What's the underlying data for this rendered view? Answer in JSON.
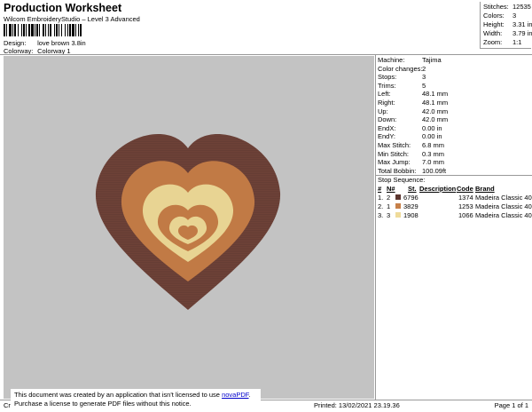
{
  "header": {
    "title": "Production Worksheet",
    "subtitle": "Wilcom EmbroideryStudio – Level 3 Advanced",
    "design_label": "Design:",
    "design_value": "love brown 3.8in",
    "colorway_label": "Colorway:",
    "colorway_value": "Colorway 1"
  },
  "stats": {
    "stitches_label": "Stitches:",
    "stitches_value": "12535",
    "colors_label": "Colors:",
    "colors_value": "3",
    "height_label": "Height:",
    "height_value": "3.31 in",
    "width_label": "Width:",
    "width_value": "3.79 in",
    "zoom_label": "Zoom:",
    "zoom_value": "1:1"
  },
  "specs": [
    {
      "label": "Machine:",
      "value": "Tajima"
    },
    {
      "label": "Color changes:",
      "value": "2"
    },
    {
      "label": "Stops:",
      "value": "3"
    },
    {
      "label": "Trims:",
      "value": "5"
    },
    {
      "label": "Left:",
      "value": "48.1 mm"
    },
    {
      "label": "Right:",
      "value": "48.1 mm"
    },
    {
      "label": "Up:",
      "value": "42.0 mm"
    },
    {
      "label": "Down:",
      "value": "42.0 mm"
    },
    {
      "label": "EndX:",
      "value": "0.00 in"
    },
    {
      "label": "EndY:",
      "value": "0.00 in"
    },
    {
      "label": "Max Stitch:",
      "value": "6.8 mm"
    },
    {
      "label": "Min Stitch:",
      "value": "0.3 mm"
    },
    {
      "label": "Max Jump:",
      "value": "7.0 mm"
    },
    {
      "label": "Total Bobbin:",
      "value": "100.09ft"
    }
  ],
  "sequence": {
    "title": "Stop Sequence:",
    "headers": {
      "num": "#",
      "n": "N#",
      "st": "St.",
      "desc": "Description",
      "code": "Code",
      "brand": "Brand"
    },
    "rows": [
      {
        "num": "1.",
        "n": "2",
        "color": "#5c3630",
        "st": "6796",
        "desc": "",
        "code": "1374",
        "brand": "Madeira Classic 40"
      },
      {
        "num": "2.",
        "n": "1",
        "color": "#c6804a",
        "st": "3829",
        "desc": "",
        "code": "1253",
        "brand": "Madeira Classic 40"
      },
      {
        "num": "3.",
        "n": "3",
        "color": "#efdb9a",
        "st": "1908",
        "desc": "",
        "code": "1066",
        "brand": "Madeira Classic 40"
      }
    ]
  },
  "design_colors": {
    "outer": "#6e4238",
    "mid": "#c17a45",
    "light": "#e8d493"
  },
  "notice": {
    "line1": "This document was created by an application that isn't licensed to use ",
    "link": "novaPDF",
    "line1_end": ".",
    "line2": "Purchase a license to generate PDF files without this notice."
  },
  "footer": {
    "left": "Cr",
    "printed": "Printed: 13/02/2021 23.19.36",
    "page": "Page 1 of 1"
  }
}
